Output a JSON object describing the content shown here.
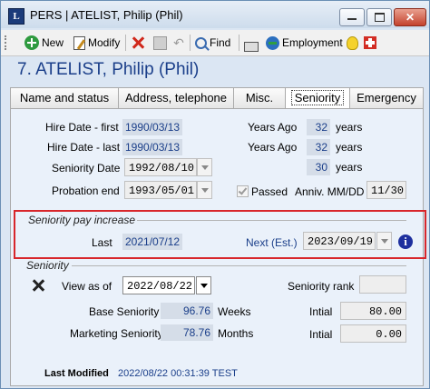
{
  "window": {
    "title": "PERS | ATELIST, Philip (Phil)",
    "app_icon_letter": "L",
    "controls": {
      "minimize": "minimize-icon",
      "maximize": "maximize-icon",
      "close": "✕"
    }
  },
  "toolbar": {
    "new_label": "New",
    "modify_label": "Modify",
    "find_label": "Find",
    "employment_label": "Employment"
  },
  "header": {
    "name": "7. ATELIST, Philip (Phil)"
  },
  "tabs": [
    {
      "label": "Name and status"
    },
    {
      "label": "Address, telephone"
    },
    {
      "label": "Misc."
    },
    {
      "label": "Seniority"
    },
    {
      "label": "Emergency"
    }
  ],
  "dates": {
    "hire_first_label": "Hire Date - first",
    "hire_first_value": "1990/03/13",
    "hire_last_label": "Hire Date - last",
    "hire_last_value": "1990/03/13",
    "seniority_date_label": "Seniority Date",
    "seniority_date_value": "1992/08/10",
    "probation_end_label": "Probation end",
    "probation_end_value": "1993/05/01"
  },
  "years": {
    "ago_label_1": "Years Ago",
    "ago_value_1": "32",
    "ago_label_2": "Years Ago",
    "ago_value_2": "32",
    "third_value": "30",
    "unit": "years"
  },
  "probation": {
    "passed_label": "Passed",
    "anniv_label": "Anniv. MM/DD",
    "anniv_value": "11/30"
  },
  "pay_increase": {
    "group_label": "Seniority pay increase",
    "last_label": "Last",
    "last_value": "2021/07/12",
    "next_label": "Next (Est.)",
    "next_value": "2023/09/19",
    "info_icon": "i"
  },
  "seniority": {
    "group_label": "Seniority",
    "view_as_of_label": "View as of",
    "view_as_of_value": "2022/08/22",
    "rank_label": "Seniority rank",
    "rank_value": "",
    "base_label": "Base Seniority",
    "base_value": "96.76",
    "base_unit": "Weeks",
    "base_initial_label": "Intial",
    "base_initial_value": "80.00",
    "marketing_label": "Marketing Seniority",
    "marketing_value": "78.76",
    "marketing_unit": "Months",
    "marketing_initial_label": "Intial",
    "marketing_initial_value": "0.00"
  },
  "footer": {
    "last_modified_label": "Last Modified",
    "last_modified_value": "2022/08/22 00:31:39 TEST"
  },
  "colors": {
    "title_blue": "#1b3f8a",
    "highlight_red": "#d8262b",
    "readonly_bg": "#d5dde8"
  }
}
